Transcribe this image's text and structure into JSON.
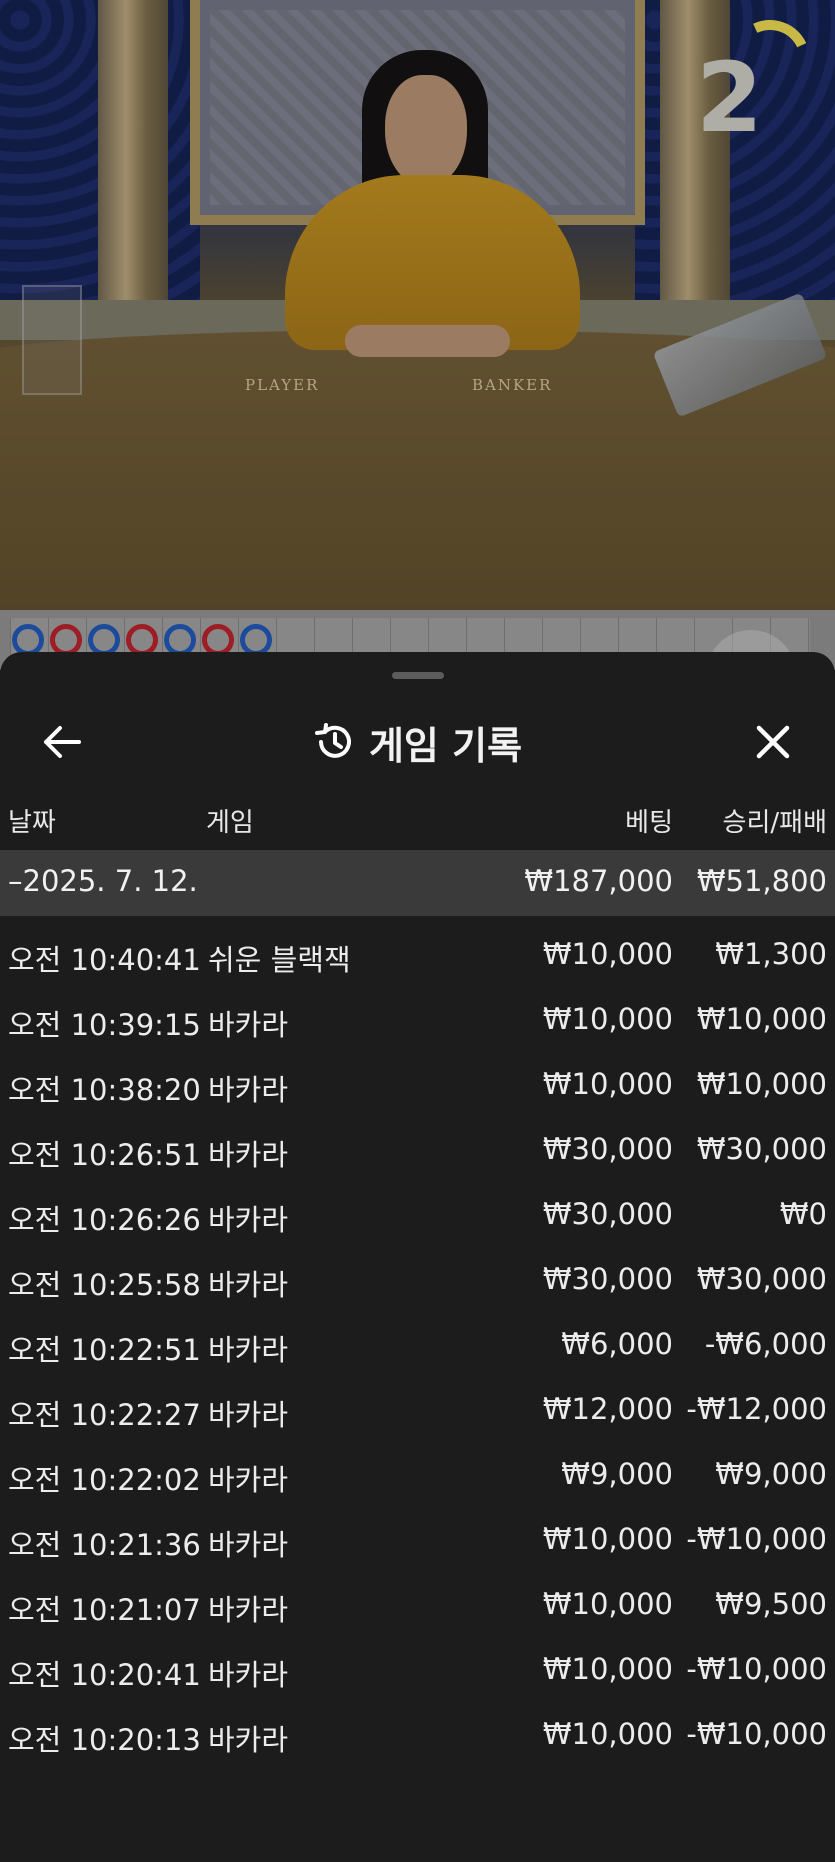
{
  "video": {
    "table_label_player": "PLAYER",
    "table_label_banker": "BANKER",
    "countdown": "2"
  },
  "road": {
    "beads": [
      "blue",
      "red",
      "blue",
      "red",
      "blue",
      "red",
      "blue"
    ]
  },
  "history": {
    "title": "게임 기록",
    "icons": {
      "back": "arrow-left-icon",
      "history": "history-clock-icon",
      "close": "close-icon"
    },
    "columns": {
      "date": "날짜",
      "game": "게임",
      "bet": "베팅",
      "win_loss": "승리/패배"
    },
    "day_summary": {
      "date": "–2025. 7. 12.",
      "bet": "₩187,000",
      "win_loss": "₩51,800"
    },
    "rows": [
      {
        "time": "오전 10:40:41",
        "game": "쉬운 블랙잭",
        "bet": "₩10,000",
        "win_loss": "₩1,300"
      },
      {
        "time": "오전 10:39:15",
        "game": "바카라",
        "bet": "₩10,000",
        "win_loss": "₩10,000"
      },
      {
        "time": "오전 10:38:20",
        "game": "바카라",
        "bet": "₩10,000",
        "win_loss": "₩10,000"
      },
      {
        "time": "오전 10:26:51",
        "game": "바카라",
        "bet": "₩30,000",
        "win_loss": "₩30,000"
      },
      {
        "time": "오전 10:26:26",
        "game": "바카라",
        "bet": "₩30,000",
        "win_loss": "₩0"
      },
      {
        "time": "오전 10:25:58",
        "game": "바카라",
        "bet": "₩30,000",
        "win_loss": "₩30,000"
      },
      {
        "time": "오전 10:22:51",
        "game": "바카라",
        "bet": "₩6,000",
        "win_loss": "-₩6,000"
      },
      {
        "time": "오전 10:22:27",
        "game": "바카라",
        "bet": "₩12,000",
        "win_loss": "-₩12,000"
      },
      {
        "time": "오전 10:22:02",
        "game": "바카라",
        "bet": "₩9,000",
        "win_loss": "₩9,000"
      },
      {
        "time": "오전 10:21:36",
        "game": "바카라",
        "bet": "₩10,000",
        "win_loss": "-₩10,000"
      },
      {
        "time": "오전 10:21:07",
        "game": "바카라",
        "bet": "₩10,000",
        "win_loss": "₩9,500"
      },
      {
        "time": "오전 10:20:41",
        "game": "바카라",
        "bet": "₩10,000",
        "win_loss": "-₩10,000"
      },
      {
        "time": "오전 10:20:13",
        "game": "바카라",
        "bet": "₩10,000",
        "win_loss": "-₩10,000"
      }
    ]
  }
}
